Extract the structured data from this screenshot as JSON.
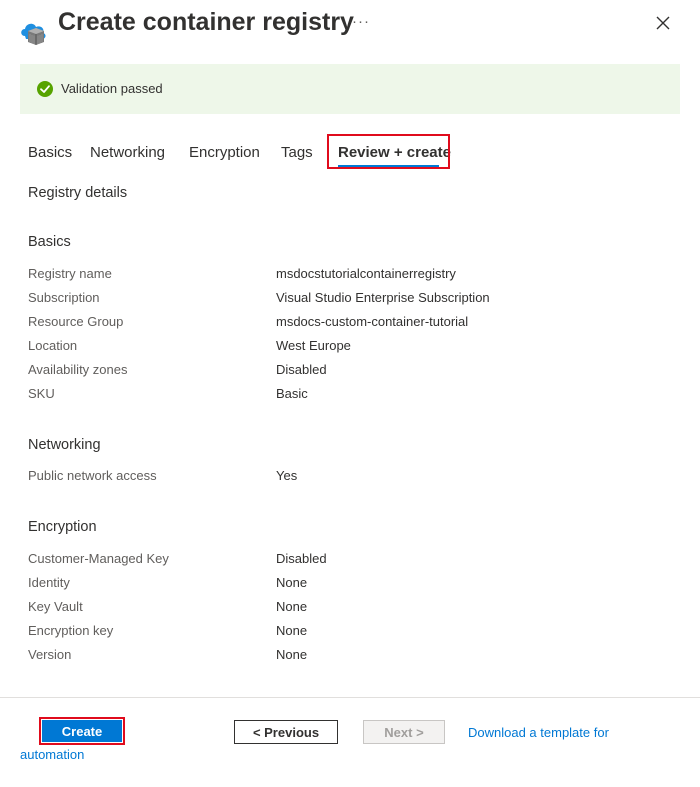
{
  "header": {
    "title": "Create container registry",
    "more_label": "···"
  },
  "banner": {
    "text": "Validation passed",
    "status_color": "#57a300"
  },
  "tabs": [
    {
      "label": "Basics"
    },
    {
      "label": "Networking"
    },
    {
      "label": "Encryption"
    },
    {
      "label": "Tags"
    },
    {
      "label": "Review + create",
      "active": true
    }
  ],
  "review": {
    "heading": "Registry details",
    "basics": {
      "title": "Basics",
      "rows": [
        {
          "label": "Registry name",
          "value": "msdocstutorialcontainerregistry"
        },
        {
          "label": "Subscription",
          "value": "Visual Studio Enterprise Subscription"
        },
        {
          "label": "Resource Group",
          "value": "msdocs-custom-container-tutorial"
        },
        {
          "label": "Location",
          "value": "West Europe"
        },
        {
          "label": "Availability zones",
          "value": "Disabled"
        },
        {
          "label": "SKU",
          "value": "Basic"
        }
      ]
    },
    "networking": {
      "title": "Networking",
      "rows": [
        {
          "label": "Public network access",
          "value": "Yes"
        }
      ]
    },
    "encryption": {
      "title": "Encryption",
      "rows": [
        {
          "label": "Customer-Managed Key",
          "value": "Disabled"
        },
        {
          "label": "Identity",
          "value": "None"
        },
        {
          "label": "Key Vault",
          "value": "None"
        },
        {
          "label": "Encryption key",
          "value": "None"
        },
        {
          "label": "Version",
          "value": "None"
        }
      ]
    }
  },
  "footer": {
    "create_label": "Create",
    "previous_label": "< Previous",
    "next_label": "Next >",
    "download_link_line1": "Download a template for",
    "download_link_line2": "automation"
  },
  "colors": {
    "accent": "#0078d4",
    "highlight": "#e00b1c",
    "banner_bg": "#eef7e9"
  }
}
